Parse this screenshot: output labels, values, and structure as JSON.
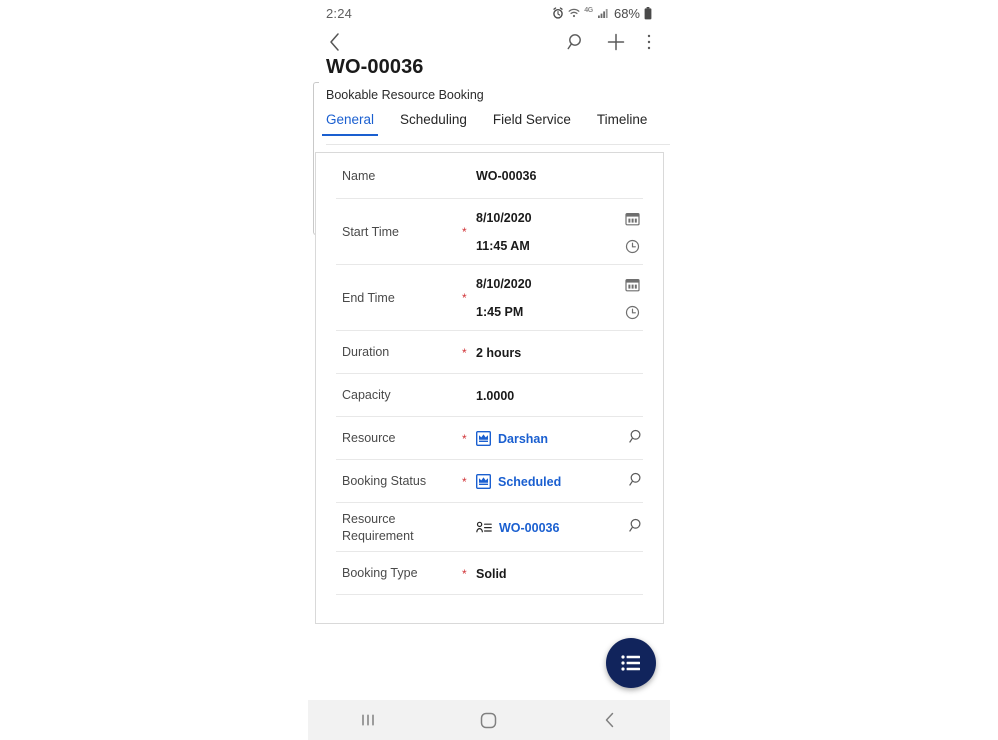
{
  "status_bar": {
    "time": "2:24",
    "network": "4G",
    "battery_percent": "68%",
    "icons": [
      "alarm-icon",
      "wifi-icon",
      "network-4g-icon",
      "signal-icon",
      "battery-icon"
    ]
  },
  "nav_bar": {
    "back": "back-icon",
    "search": "search-icon",
    "add": "add-icon",
    "more": "more-options-icon"
  },
  "header": {
    "title": "WO-00036",
    "subtitle": "Bookable Resource Booking"
  },
  "tabs": [
    {
      "label": "General",
      "active": true
    },
    {
      "label": "Scheduling",
      "active": false
    },
    {
      "label": "Field Service",
      "active": false
    },
    {
      "label": "Timeline",
      "active": false
    }
  ],
  "form": {
    "name": {
      "label": "Name",
      "value": "WO-00036",
      "required": ""
    },
    "start_time": {
      "label": "Start Time",
      "required": "*",
      "date": "8/10/2020",
      "time": "11:45 AM",
      "date_icon": "calendar-icon",
      "time_icon": "clock-icon"
    },
    "end_time": {
      "label": "End Time",
      "required": "*",
      "date": "8/10/2020",
      "time": "1:45 PM",
      "date_icon": "calendar-icon",
      "time_icon": "clock-icon"
    },
    "duration": {
      "label": "Duration",
      "required": "*",
      "value": "2 hours"
    },
    "capacity": {
      "label": "Capacity",
      "required": "",
      "value": "1.0000"
    },
    "resource": {
      "label": "Resource",
      "required": "*",
      "value": "Darshan",
      "entity_icon": "bookable-resource-icon",
      "lookup_icon": "search-icon"
    },
    "booking_status": {
      "label": "Booking Status",
      "required": "*",
      "value": "Scheduled",
      "entity_icon": "bookable-resource-icon",
      "lookup_icon": "search-icon"
    },
    "resource_requirement": {
      "label": "Resource Requirement",
      "required": "",
      "value": "WO-00036",
      "entity_icon": "resource-requirement-icon",
      "lookup_icon": "search-icon"
    },
    "booking_type": {
      "label": "Booking Type",
      "required": "*",
      "value": "Solid"
    }
  },
  "fab": {
    "icon": "list-menu-icon"
  },
  "android_nav": {
    "recents": "recents-icon",
    "home": "home-icon",
    "back": "back-icon"
  },
  "colors": {
    "accent": "#1a5fd0",
    "required": "#d13438",
    "fab": "#11245c",
    "label": "#4a4a4a",
    "value": "#1a1a1a",
    "divider": "#e8e8e8",
    "card_border": "#d9d9d9",
    "android_nav_bg": "#f2f2f2"
  }
}
